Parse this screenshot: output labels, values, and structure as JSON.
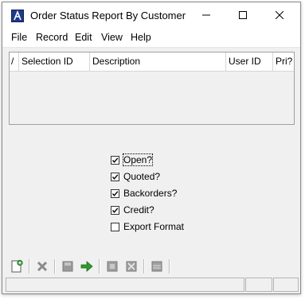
{
  "window": {
    "title": "Order Status Report By Customer",
    "app_icon": "abs-logo-icon",
    "controls": [
      "minimize-icon",
      "maximize-icon",
      "close-icon"
    ]
  },
  "menu": {
    "items": [
      "File",
      "Record",
      "Edit",
      "View",
      "Help"
    ]
  },
  "grid": {
    "sort_indicator": "/",
    "columns": [
      "Selection ID",
      "Description",
      "User ID",
      "Pri?"
    ],
    "rows": []
  },
  "options": [
    {
      "label": "Open?",
      "checked": true,
      "focused": true
    },
    {
      "label": "Quoted?",
      "checked": true,
      "focused": false
    },
    {
      "label": "Backorders?",
      "checked": true,
      "focused": false
    },
    {
      "label": "Credit?",
      "checked": true,
      "focused": false
    },
    {
      "label": "Export Format",
      "checked": false,
      "focused": false
    }
  ],
  "toolbar": {
    "buttons": [
      "new-record-icon",
      "delete-icon",
      "save-icon",
      "run-arrow-icon",
      "copy-icon",
      "clear-icon",
      "list-icon"
    ]
  },
  "colors": {
    "window_bg": "#f0f0f0",
    "titlebar_bg": "#ffffff",
    "icon_green": "#2e8b2e",
    "icon_gray": "#7f7f7f",
    "app_icon_blue": "#1e3a8a"
  }
}
